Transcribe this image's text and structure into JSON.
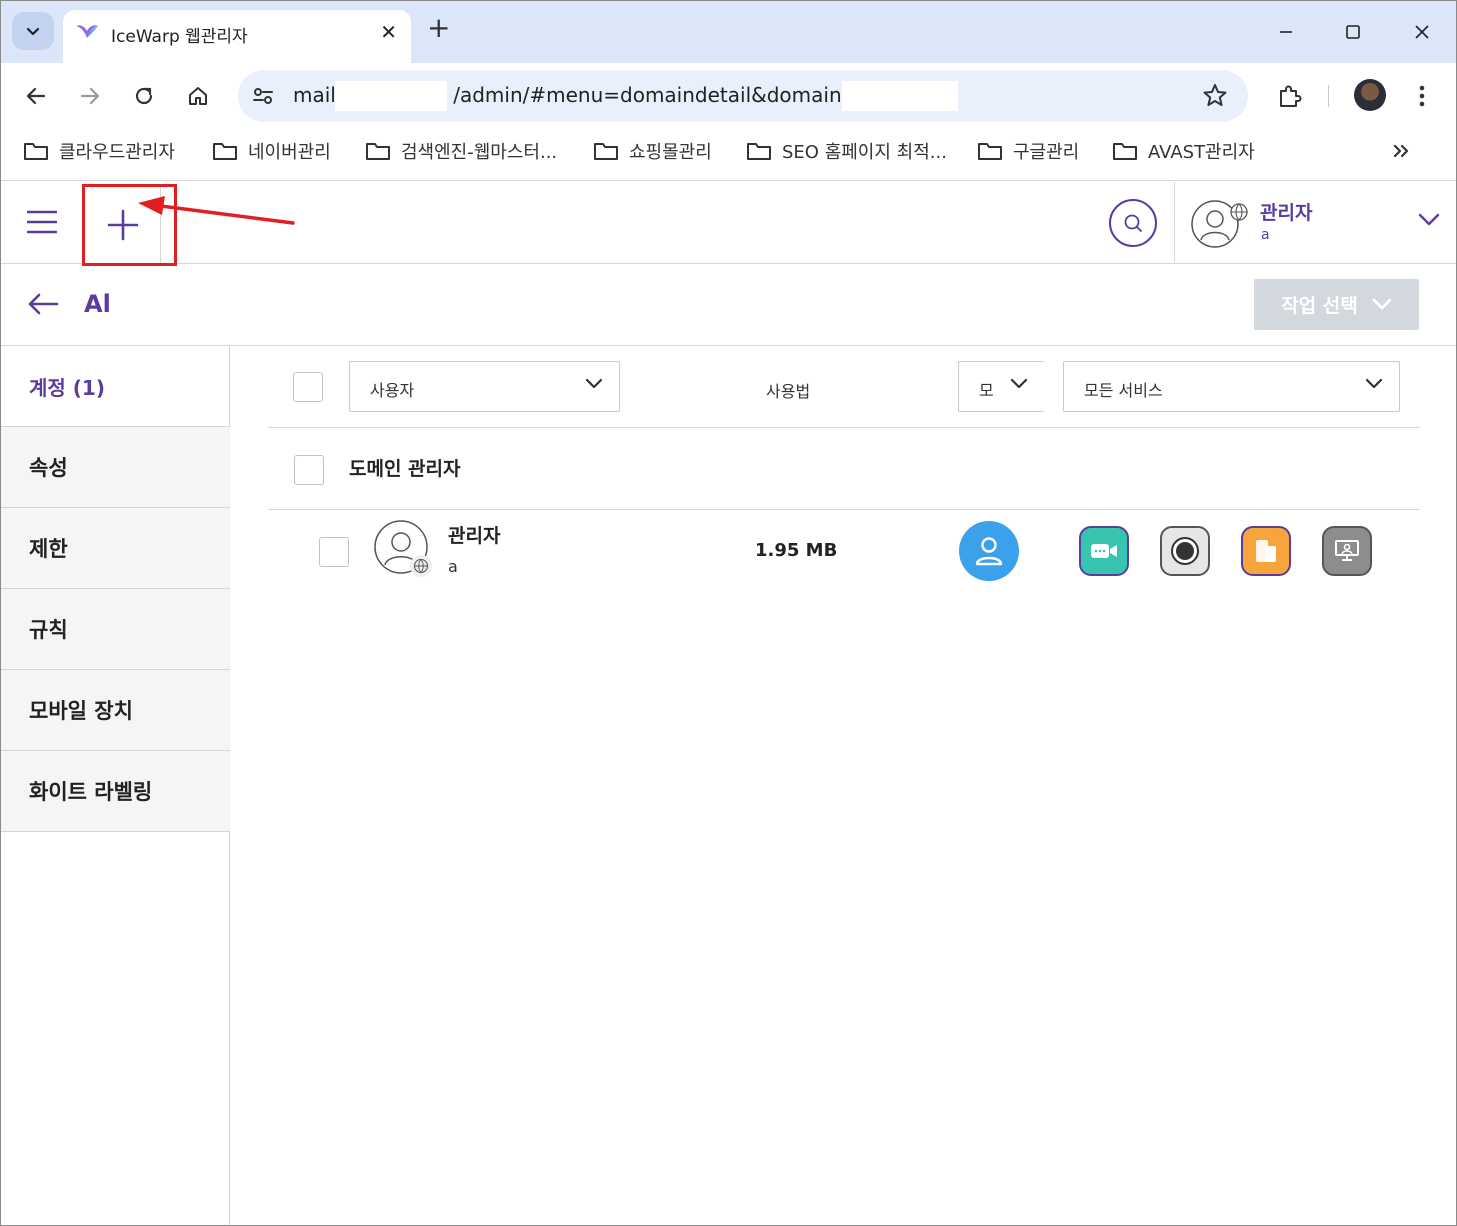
{
  "browser": {
    "tab_title": "IceWarp 웹관리자",
    "url_prefix": "mail.",
    "url_path": "/admin/#menu=domaindetail&domain=a"
  },
  "bookmarks": [
    {
      "label": "클라우드관리자"
    },
    {
      "label": "네이버관리"
    },
    {
      "label": "검색엔진-웹마스터..."
    },
    {
      "label": "쇼핑몰관리"
    },
    {
      "label": "SEO 홈페이지 최적..."
    },
    {
      "label": "구글관리"
    },
    {
      "label": "AVAST관리자"
    }
  ],
  "header": {
    "user_name": "관리자",
    "user_sub": "a"
  },
  "subheader": {
    "title": "Al",
    "action_label": "작업 선택"
  },
  "sidebar": {
    "active_label": "계정 (1)",
    "items": [
      {
        "label": "속성"
      },
      {
        "label": "제한"
      },
      {
        "label": "규칙"
      },
      {
        "label": "모바일 장치"
      },
      {
        "label": "화이트 라벨링"
      }
    ]
  },
  "filters": {
    "user_type": "사용자",
    "usage_header": "사용법",
    "mode": "모",
    "services": "모든 서비스"
  },
  "group": {
    "title": "도메인 관리자"
  },
  "row": {
    "name": "관리자",
    "sub": "a",
    "size": "1.95 MB"
  },
  "colors": {
    "accent": "#5b3c9e",
    "highlight_red": "#e02020",
    "user_blue": "#3aa1ea"
  },
  "icons": {
    "services": [
      "video-call-icon",
      "record-icon",
      "mobile-devices-icon",
      "presentation-icon"
    ]
  }
}
